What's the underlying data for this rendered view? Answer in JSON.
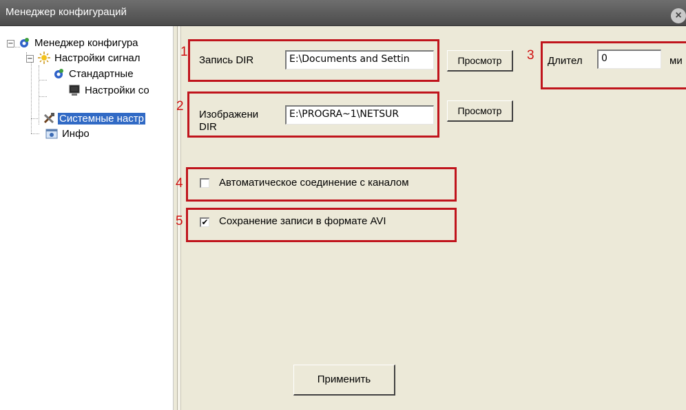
{
  "window": {
    "title": "Менеджер конфигураций",
    "close_icon": "close-icon"
  },
  "tree": {
    "root": "Менеджер конфигура",
    "signal_settings": "Настройки сигнал",
    "standard": "Стандартные",
    "connection_settings": "Настройки со",
    "system_settings": "Системные настр",
    "info": "Инфо",
    "expander_minus": "−"
  },
  "form": {
    "n1": "1",
    "n2": "2",
    "n3": "3",
    "n4": "4",
    "n5": "5",
    "record_dir_label": "Запись DIR",
    "record_dir_value": "E:\\Documents and Settin",
    "image_dir_label_1": "Изображени",
    "image_dir_label_2": "DIR",
    "image_dir_value": "E:\\PROGRA~1\\NETSUR",
    "browse_label": "Просмотр",
    "duration_label": "Длител",
    "duration_value": "0",
    "duration_unit": "ми",
    "auto_connect_label": "Автоматическое соединение с каналом",
    "auto_connect_checked": false,
    "save_avi_label": "Сохранение записи в формате AVI",
    "save_avi_checked": true,
    "check_mark": "✔",
    "apply_label": "Применить"
  },
  "colors": {
    "highlight": "#c0141c",
    "selection": "#316ac5"
  }
}
